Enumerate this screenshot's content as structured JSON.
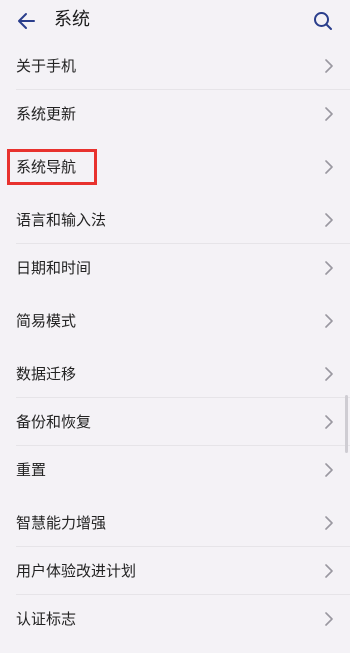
{
  "header": {
    "title": "系统",
    "back_icon": "back-arrow-icon",
    "search_icon": "search-icon"
  },
  "settings": [
    {
      "label": "关于手机",
      "group": 1
    },
    {
      "label": "系统更新",
      "group": 1
    },
    {
      "label": "系统导航",
      "group": 2,
      "highlighted": true
    },
    {
      "label": "语言和输入法",
      "group": 3
    },
    {
      "label": "日期和时间",
      "group": 3
    },
    {
      "label": "简易模式",
      "group": 4
    },
    {
      "label": "数据迁移",
      "group": 5
    },
    {
      "label": "备份和恢复",
      "group": 5
    },
    {
      "label": "重置",
      "group": 5
    },
    {
      "label": "智慧能力增强",
      "group": 6
    },
    {
      "label": "用户体验改进计划",
      "group": 6
    },
    {
      "label": "认证标志",
      "group": 6
    }
  ],
  "colors": {
    "highlight_border": "#e8322e",
    "accent": "#2a3e8c"
  }
}
